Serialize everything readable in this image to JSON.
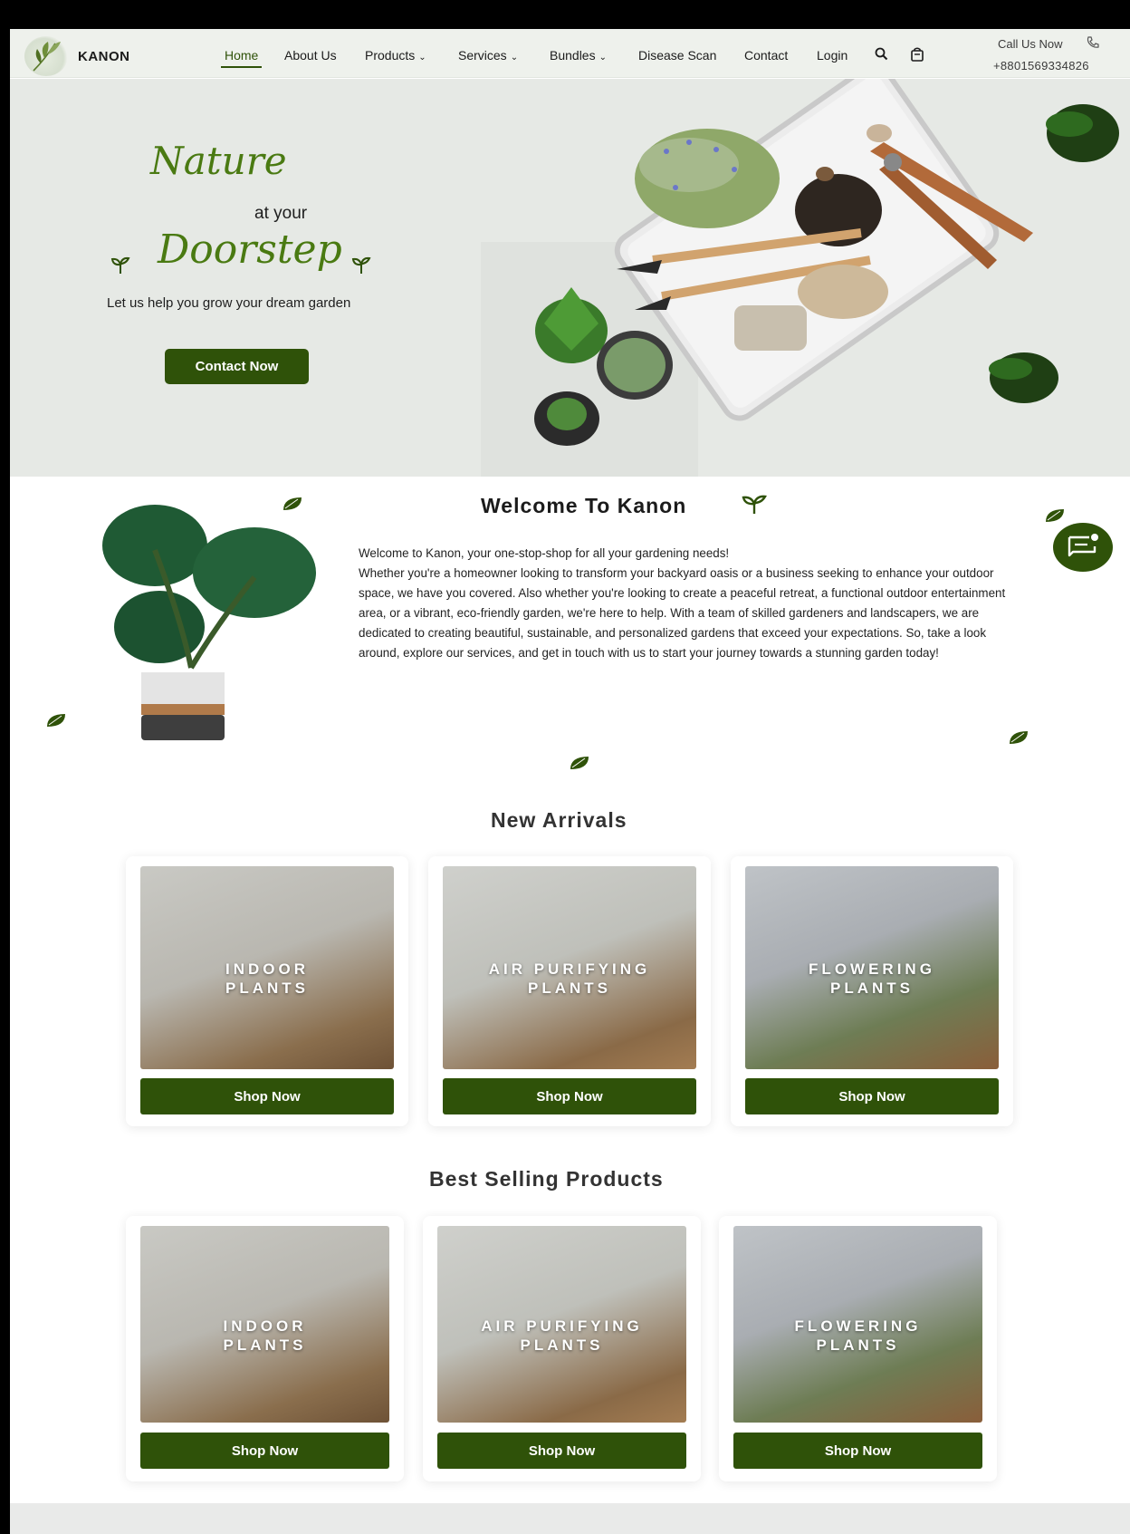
{
  "brand": {
    "name": "KANON"
  },
  "nav": {
    "items": [
      {
        "label": "Home",
        "dropdown": false
      },
      {
        "label": "About Us",
        "dropdown": false
      },
      {
        "label": "Products",
        "dropdown": true
      },
      {
        "label": "Services",
        "dropdown": true
      },
      {
        "label": "Bundles",
        "dropdown": true
      },
      {
        "label": "Disease Scan",
        "dropdown": false
      },
      {
        "label": "Contact",
        "dropdown": false
      },
      {
        "label": "Login",
        "dropdown": false
      }
    ],
    "icons": [
      "search-icon",
      "shopping-bag-icon",
      "phone-icon"
    ],
    "call_label": "Call Us Now",
    "call_number": "+8801569334826"
  },
  "hero": {
    "line1": "Nature",
    "line2": "at your",
    "line3": "Doorstep",
    "tagline": "Let us help you grow your dream garden",
    "cta": "Contact Now"
  },
  "welcome": {
    "title": "Welcome To Kanon",
    "intro": "Welcome to Kanon, your one-stop-shop for all your gardening needs!",
    "body": "Whether you're a homeowner looking to transform your backyard oasis or a business seeking to enhance your outdoor space, we have you covered. Also whether you're looking to create a peaceful retreat, a functional outdoor entertainment area, or a vibrant, eco-friendly garden, we're here to help. With a team of skilled gardeners and landscapers, we are dedicated to creating beautiful, sustainable, and personalized gardens that exceed your expectations. So, take a look around, explore our services, and get in touch with us to start your journey towards a stunning garden today!"
  },
  "new_arrivals": {
    "title": "New Arrivals",
    "cards": [
      {
        "line1": "INDOOR",
        "line2": "PLANTS",
        "button": "Shop Now"
      },
      {
        "line1": "AIR PURIFYING",
        "line2": "PLANTS",
        "button": "Shop Now"
      },
      {
        "line1": "FLOWERING",
        "line2": "PLANTS",
        "button": "Shop Now"
      }
    ]
  },
  "best_selling": {
    "title": "Best Selling Products",
    "cards": [
      {
        "line1": "INDOOR",
        "line2": "PLANTS",
        "button": "Shop Now"
      },
      {
        "line1": "AIR PURIFYING",
        "line2": "PLANTS",
        "button": "Shop Now"
      },
      {
        "line1": "FLOWERING",
        "line2": "PLANTS",
        "button": "Shop Now"
      }
    ]
  },
  "colors": {
    "accent": "#2f5209",
    "nav_bg": "#eef1ec",
    "hero_bg": "#e6e9e5",
    "script_green": "#4a7a12"
  }
}
